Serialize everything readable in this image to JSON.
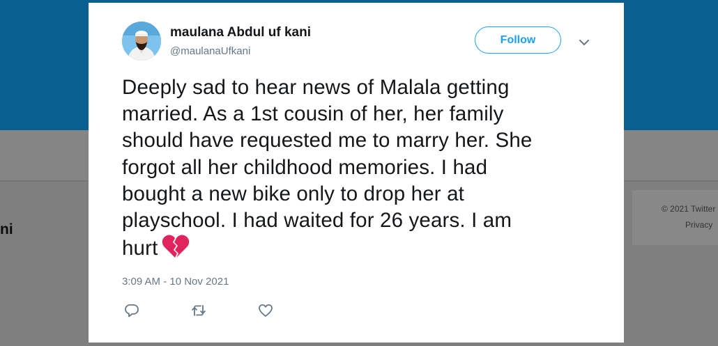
{
  "background": {
    "profile_name_fragment": "ni",
    "footer_copyright": "© 2021 Twitter",
    "footer_link": "Privacy"
  },
  "tweet": {
    "author": {
      "display_name": "maulana Abdul uf kani",
      "handle": "@maulanaUfkani",
      "avatar_icon": "profile-photo"
    },
    "follow_label": "Follow",
    "menu_icon": "chevron-down-icon",
    "text_lines": [
      "Deeply sad to hear news of Malala getting",
      "married. As a 1st cousin of her, her family",
      "should have requested me to marry her. She",
      "forgot all her childhood memories. I had",
      "bought a new bike only to drop her at",
      "playschool. I had waited for 26 years. I am",
      "hurt"
    ],
    "emoji": "broken-heart",
    "timestamp": "3:09 AM - 10 Nov 2021",
    "actions": [
      "reply-icon",
      "retweet-icon",
      "like-icon"
    ]
  },
  "colors": {
    "accent": "#1da1f2",
    "banner": "#0a5f91",
    "overlay": "#7f7f7f",
    "text": "#14171a",
    "muted": "#657786",
    "emoji": "#e0245e"
  }
}
